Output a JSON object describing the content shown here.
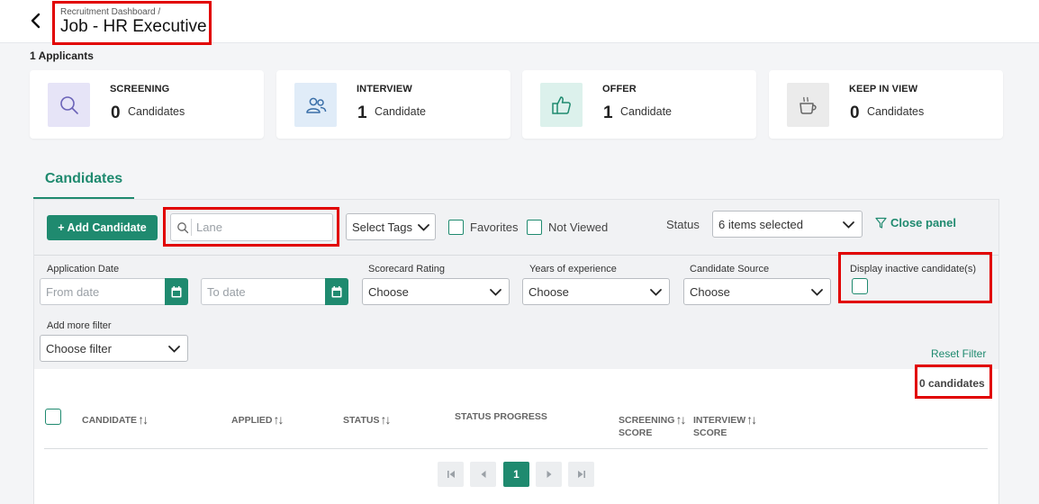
{
  "header": {
    "breadcrumb": "Recruitment Dashboard /",
    "title": "Job - HR Executive"
  },
  "applicants_count": "1 Applicants",
  "stats": [
    {
      "label": "SCREENING",
      "count": "0",
      "unit": "Candidates",
      "icon": "search-icon",
      "bg": "#e6e4f7"
    },
    {
      "label": "INTERVIEW",
      "count": "1",
      "unit": "Candidate",
      "icon": "people-icon",
      "bg": "#e0ecf8"
    },
    {
      "label": "OFFER",
      "count": "1",
      "unit": "Candidate",
      "icon": "thumbs-up-icon",
      "bg": "#dcf1ec"
    },
    {
      "label": "KEEP IN VIEW",
      "count": "0",
      "unit": "Candidates",
      "icon": "coffee-cup-icon",
      "bg": "#ebebeb"
    }
  ],
  "tab": {
    "label": "Candidates"
  },
  "toolbar": {
    "add_label": "+ Add Candidate",
    "search_value": "",
    "search_placeholder": "Lane",
    "tags_label": "Select Tags",
    "favorites_label": "Favorites",
    "not_viewed_label": "Not Viewed",
    "status_label": "Status",
    "status_value": "6 items selected",
    "close_panel_label": "Close panel"
  },
  "filters": {
    "application_date_label": "Application Date",
    "from_placeholder": "From date",
    "to_placeholder": "To date",
    "scorecard_label": "Scorecard Rating",
    "scorecard_value": "Choose",
    "experience_label": "Years of experience",
    "experience_value": "Choose",
    "source_label": "Candidate Source",
    "source_value": "Choose",
    "inactive_label": "Display inactive candidate(s)",
    "more_filter_label": "Add more filter",
    "more_filter_value": "Choose filter",
    "reset_label": "Reset Filter"
  },
  "results": {
    "count_text": "0 candidates",
    "columns": {
      "candidate": "CANDIDATE",
      "applied": "APPLIED",
      "status": "STATUS",
      "status_progress": "STATUS PROGRESS",
      "screening_l1": "SCREENING",
      "screening_l2": "SCORE",
      "interview_l1": "INTERVIEW",
      "interview_l2": "SCORE"
    },
    "sort_glyph": "↑↓"
  },
  "pagination": {
    "current_page": "1"
  },
  "colors": {
    "accent": "#1f8a6f",
    "highlight_box": "#e10000"
  }
}
